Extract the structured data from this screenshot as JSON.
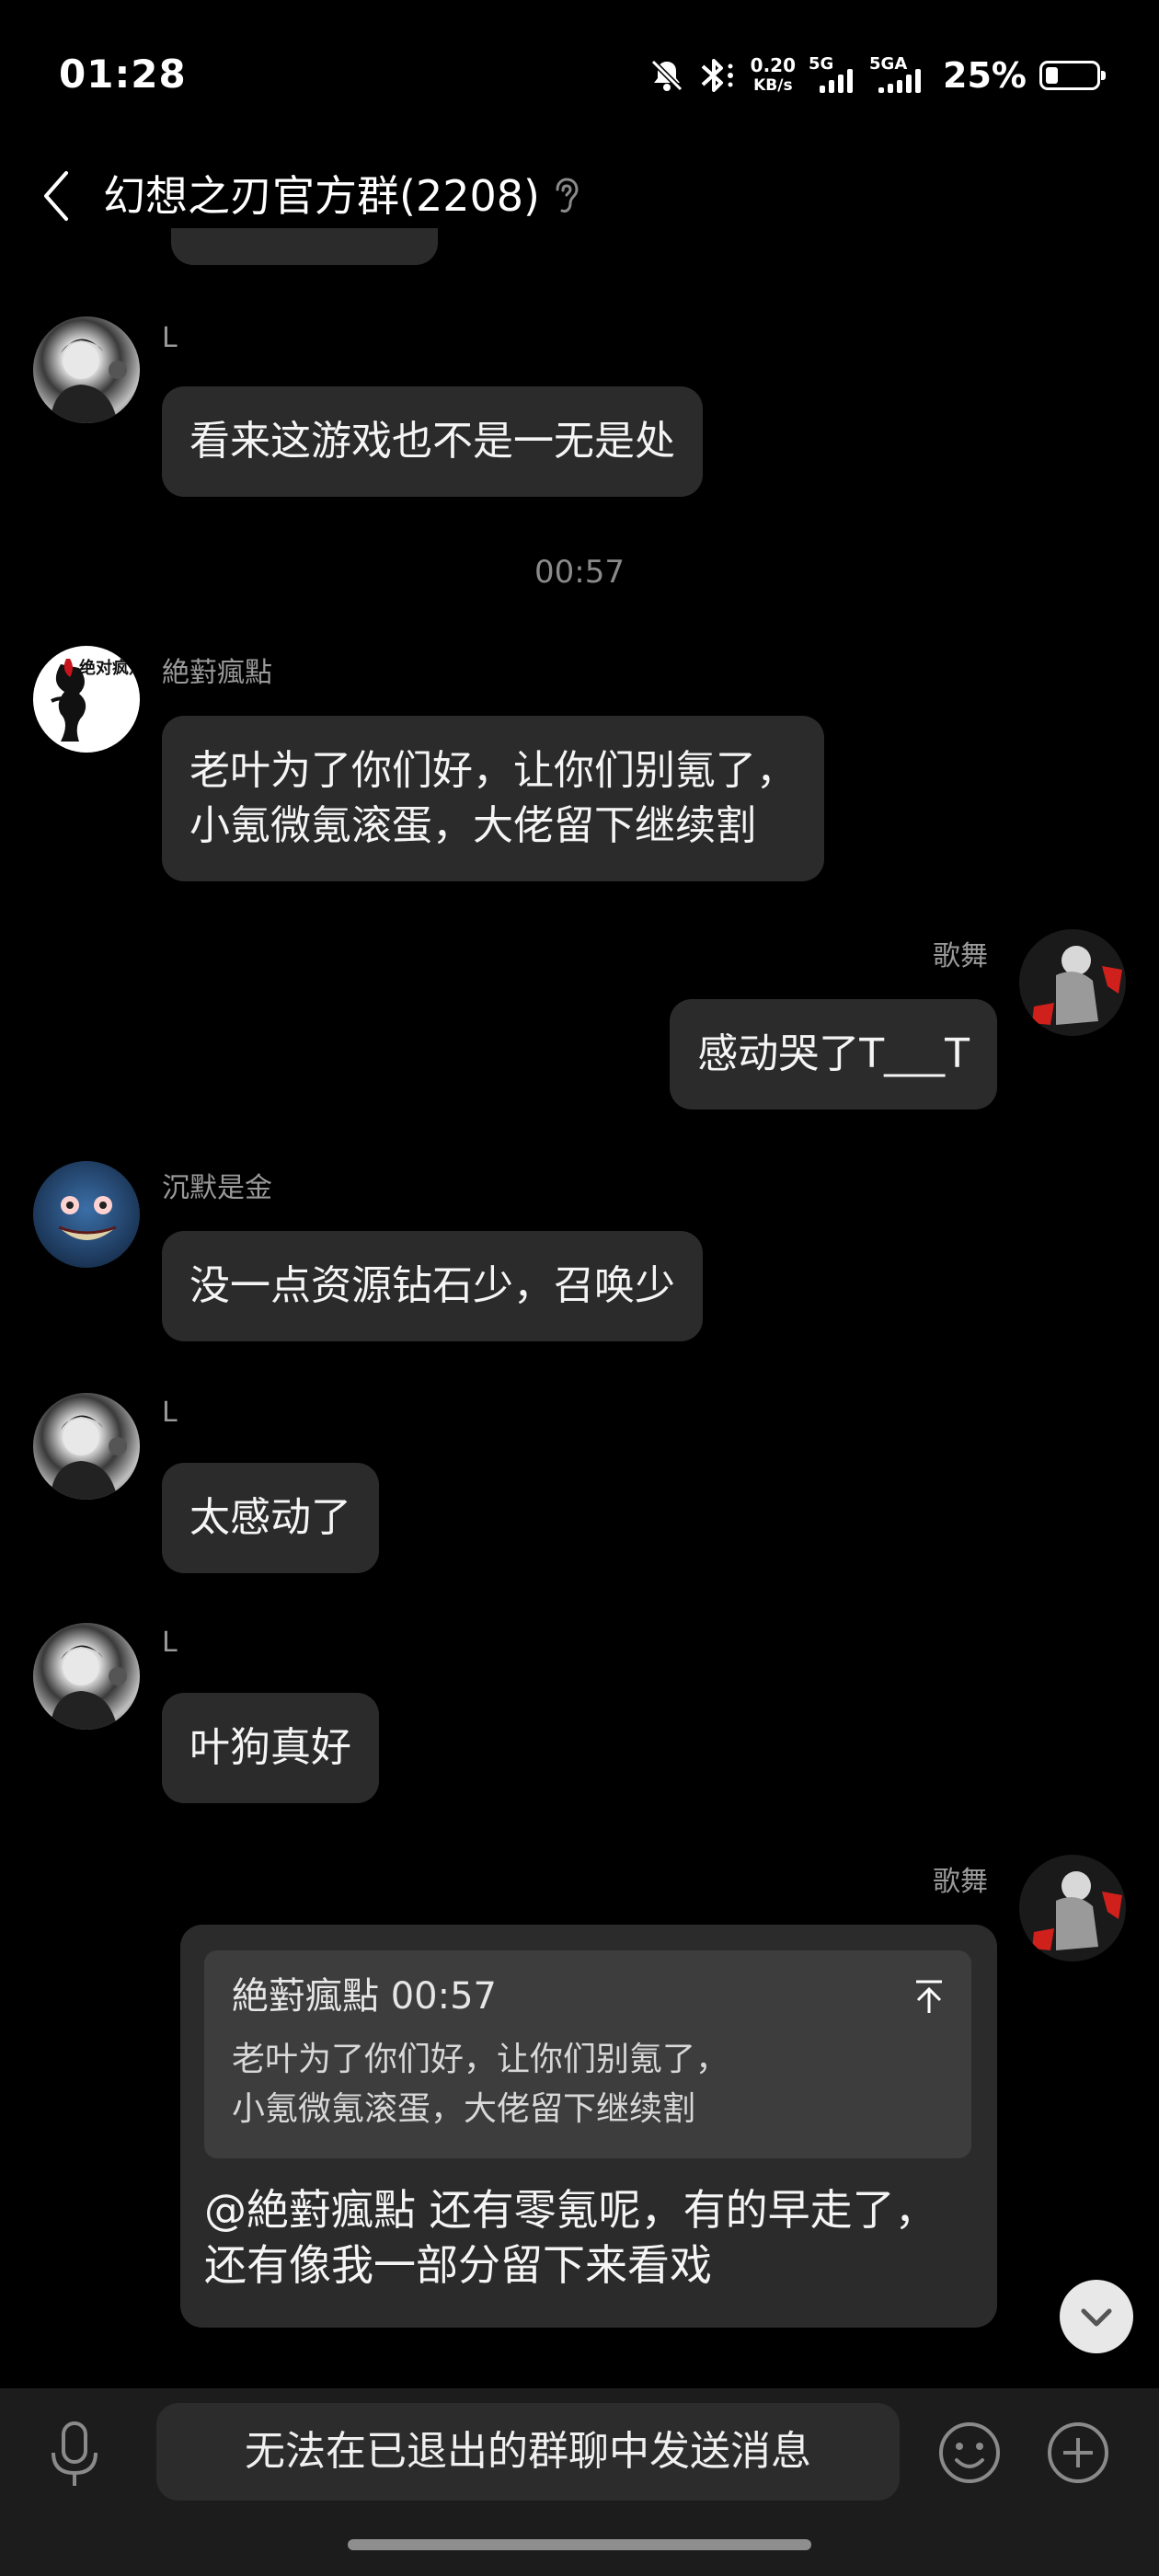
{
  "status_bar": {
    "time": "01:28",
    "net_speed_value": "0.20",
    "net_speed_unit": "KB/s",
    "signal1_label": "5G",
    "signal2_label": "5GA",
    "battery": "25%",
    "icons": [
      "mute-icon",
      "bluetooth-icon",
      "signal-icon",
      "battery-icon"
    ]
  },
  "header": {
    "title": "幻想之刃官方群(2208)",
    "icons": [
      "back-icon",
      "ear-icon"
    ]
  },
  "messages": [
    {
      "sender": "L",
      "text": "看来这游戏也不是一无是处",
      "side": "left"
    },
    {
      "timestamp": "00:57"
    },
    {
      "sender": "絶薱瘋點",
      "text": "老叶为了你们好，让你们别氪了，\n小氪微氪滚蛋，大佬留下继续割",
      "side": "left",
      "avatar_text": "绝对疯点"
    },
    {
      "sender": "歌舞",
      "text": "感动哭了T___T",
      "side": "right"
    },
    {
      "sender": "沉默是金",
      "text": "没一点资源钻石少，召唤少",
      "side": "left"
    },
    {
      "sender": "L",
      "text": "太感动了",
      "side": "left"
    },
    {
      "sender": "L",
      "text": "叶狗真好",
      "side": "left"
    },
    {
      "sender": "歌舞",
      "side": "right",
      "quote": {
        "author": "絶薱瘋點",
        "time": "00:57",
        "text": "老叶为了你们好，让你们别氪了，\n小氪微氪滚蛋，大佬留下继续割"
      },
      "text": "@絶薱瘋點 还有零氪呢，有的早走了，\n还有像我一部分留下来看戏"
    }
  ],
  "bottom_bar": {
    "disabled_input_text": "无法在已退出的群聊中发送消息",
    "icons": [
      "microphone-icon",
      "emoji-icon",
      "plus-icon"
    ]
  },
  "colors": {
    "background": "#000000",
    "bubble": "#2b2b2b",
    "quote": "#3d3d3d",
    "bottom_bar": "#1c1c1c"
  }
}
